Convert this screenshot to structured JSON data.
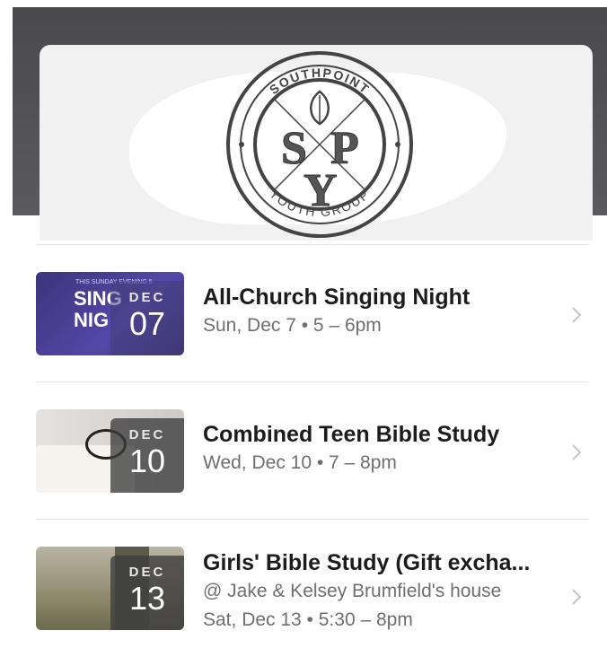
{
  "banner": {
    "logo_top_text": "SOUTHPOINT",
    "logo_bottom_text": "YOUTH GROUP",
    "logo_letters": [
      "S",
      "P",
      "Y"
    ]
  },
  "events": [
    {
      "thumb_caption_small": "THIS SUNDAY EVENING 5",
      "thumb_caption_line1": "SING",
      "thumb_caption_line2": "NIG",
      "month": "DEC",
      "day": "07",
      "title": "All-Church Singing Night",
      "subtitle": "Sun, Dec 7 • 5 – 6pm"
    },
    {
      "month": "DEC",
      "day": "10",
      "title": "Combined Teen Bible Study",
      "subtitle": "Wed, Dec 10 • 7 – 8pm"
    },
    {
      "month": "DEC",
      "day": "13",
      "title": "Girls' Bible Study (Gift excha...",
      "location": "@ Jake & Kelsey Brumfield's house",
      "subtitle": "Sat, Dec 13 • 5:30 – 8pm"
    }
  ],
  "colors": {
    "header_band": "#4a4a4c",
    "secondary_text": "#6e6e73",
    "separator": "#e3e3e6"
  },
  "icons": {
    "row_disclosure": "chevron-right-icon"
  }
}
